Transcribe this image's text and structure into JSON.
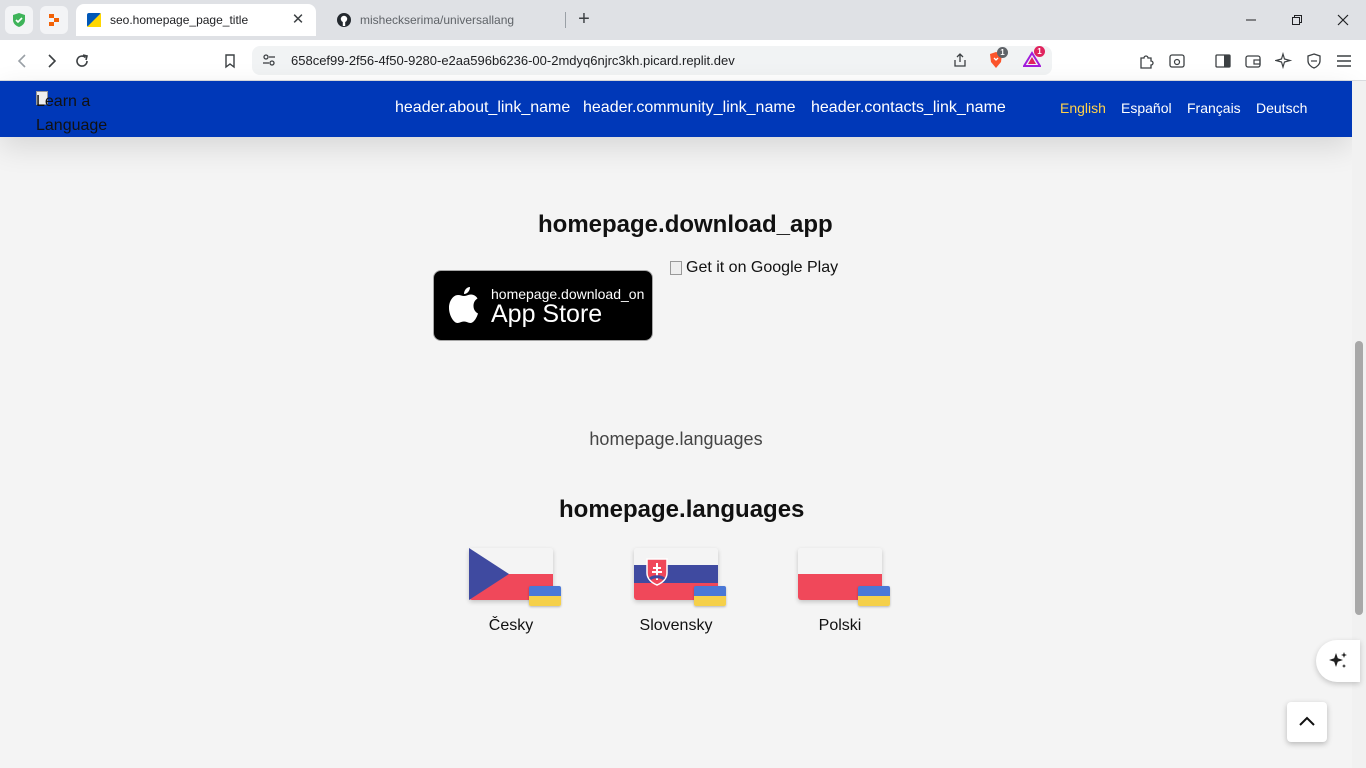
{
  "browser": {
    "tabs": [
      {
        "title": "seo.homepage_page_title",
        "active": true
      },
      {
        "title": "misheckserima/universallang",
        "active": false
      }
    ],
    "url": "658cef99-2f56-4f50-9280-e2aa596b6236-00-2mdyq6njrc3kh.picard.replit.dev",
    "badges": {
      "brave_shields": "1",
      "rewards": "1"
    }
  },
  "header": {
    "logo_alt": "Learn a Language",
    "nav": [
      "header.about_link_name",
      "header.community_link_name",
      "header.contacts_link_name"
    ],
    "languages": [
      "English",
      "Español",
      "Français",
      "Deutsch"
    ],
    "active_language": "English",
    "colors": {
      "background": "#0038b8",
      "active_language": "#ffd24a"
    }
  },
  "download": {
    "title": "homepage.download_app",
    "appstore_small": "homepage.download_on",
    "appstore_big": "App Store",
    "googleplay_alt": "Get it on Google Play"
  },
  "languages_section": {
    "subtitle": "homepage.languages",
    "title": "homepage.languages",
    "items": [
      {
        "name": "Česky",
        "flag": "czech-flag"
      },
      {
        "name": "Slovensky",
        "flag": "slovak-flag"
      },
      {
        "name": "Polski",
        "flag": "polish-flag"
      }
    ]
  }
}
